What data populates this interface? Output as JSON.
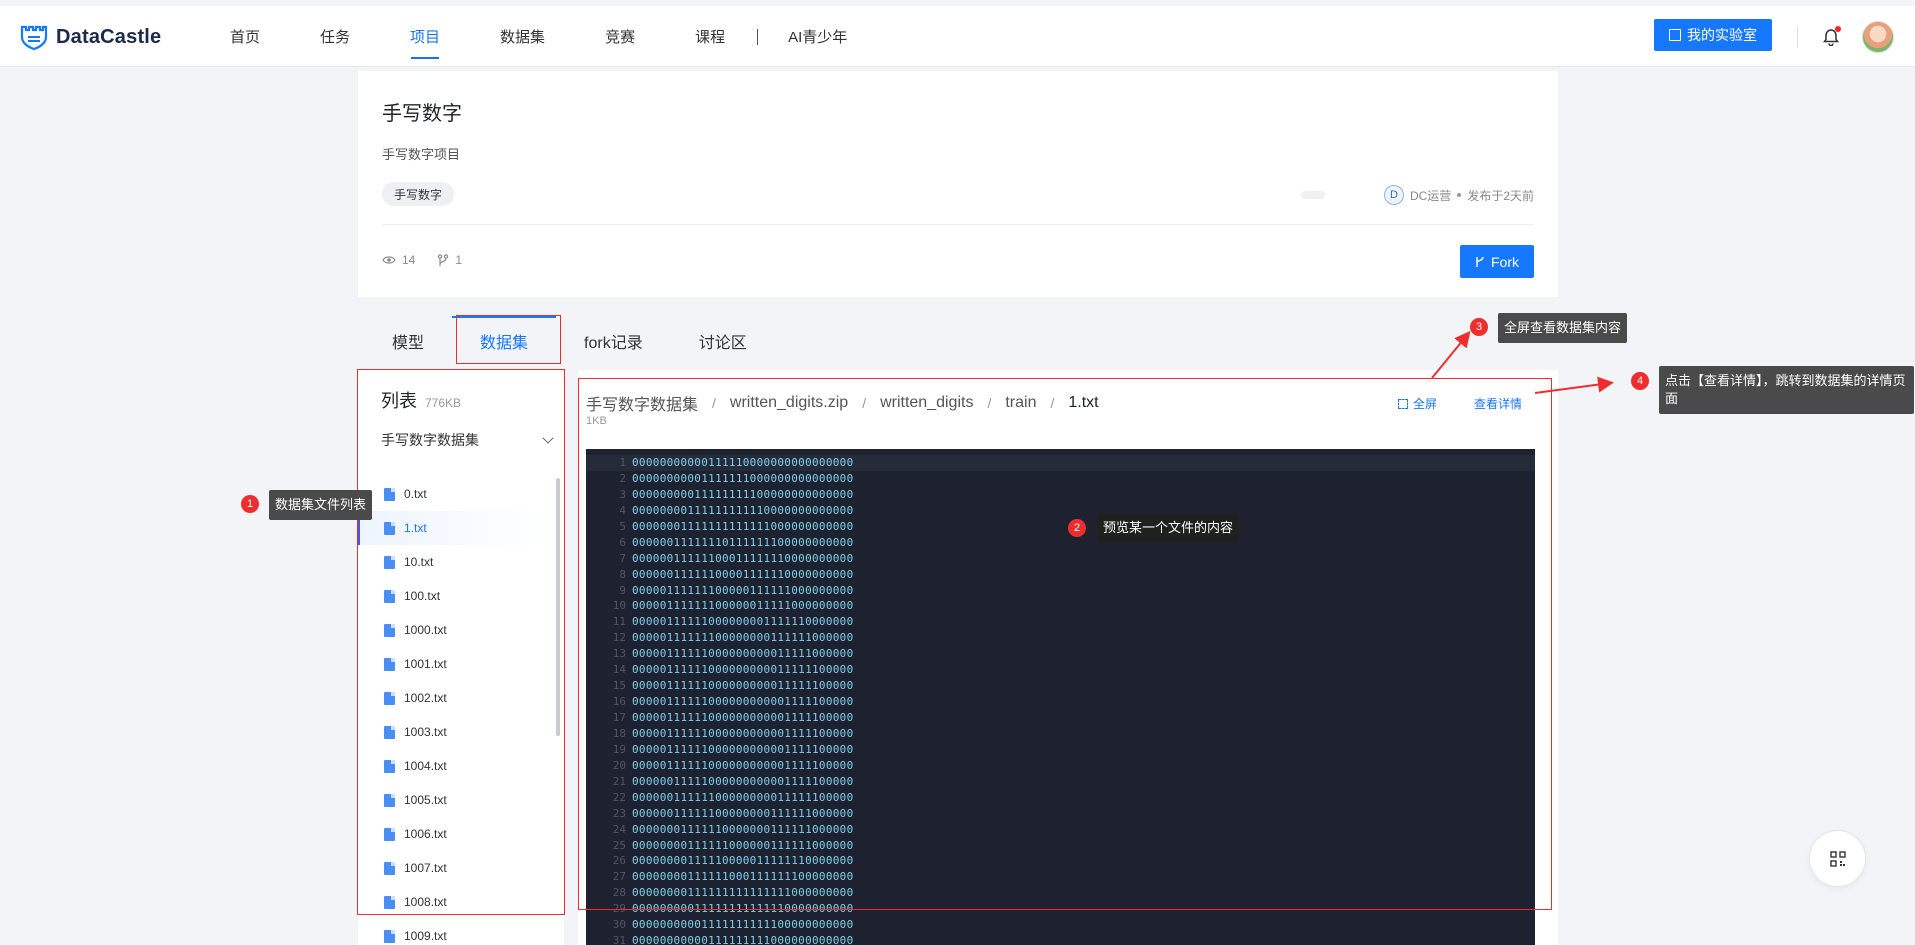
{
  "nav": {
    "brand": "DataCastle",
    "items": [
      {
        "label": "首页",
        "active": false
      },
      {
        "label": "任务",
        "active": false
      },
      {
        "label": "项目",
        "active": true
      },
      {
        "label": "数据集",
        "active": false
      },
      {
        "label": "竞赛",
        "active": false
      },
      {
        "label": "课程",
        "active": false
      }
    ],
    "extra_item": "AI青少年",
    "lab_button": "我的实验室"
  },
  "project": {
    "title": "手写数字",
    "description": "手写数字项目",
    "tag": "手写数字",
    "author_initial": "D",
    "author": "DC运营",
    "published": "发布于2天前",
    "views": "14",
    "forks": "1",
    "fork_button": "Fork"
  },
  "tabs": [
    "模型",
    "数据集",
    "fork记录",
    "讨论区"
  ],
  "active_tab": "数据集",
  "file_panel": {
    "title": "列表",
    "size": "776KB",
    "dataset": "手写数字数据集",
    "files": [
      "0.txt",
      "1.txt",
      "10.txt",
      "100.txt",
      "1000.txt",
      "1001.txt",
      "1002.txt",
      "1003.txt",
      "1004.txt",
      "1005.txt",
      "1006.txt",
      "1007.txt",
      "1008.txt",
      "1009.txt"
    ],
    "selected": "1.txt"
  },
  "preview": {
    "breadcrumb": [
      "手写数字数据集",
      "written_digits.zip",
      "written_digits",
      "train",
      "1.txt"
    ],
    "file_size": "1KB",
    "fullscreen": "全屏",
    "view_details": "查看详情",
    "lines": [
      "00000000000111110000000000000000",
      "00000000001111111000000000000000",
      "00000000011111111100000000000000",
      "00000000111111111110000000000000",
      "00000001111111111111000000000000",
      "00000011111110111111100000000000",
      "00000011111100011111110000000000",
      "00000011111100001111110000000000",
      "00000111111100000111111000000000",
      "00000111111100000011111000000000",
      "00000111111000000001111110000000",
      "00000111111100000000111111000000",
      "00000111111000000000011111000000",
      "00000111111000000000011111100000",
      "00000111111000000000011111100000",
      "00000111111000000000001111100000",
      "00000111111000000000001111100000",
      "00000111111000000000001111100000",
      "00000111111000000000001111100000",
      "00000111111000000000001111100000",
      "00000011111000000000001111100000",
      "00000011111100000000011111100000",
      "00000011111100000000111111000000",
      "00000001111110000000111111000000",
      "00000000111111000000111111000000",
      "00000000111110000011111110000000",
      "00000000111111000111111100000000",
      "00000000111111111111111000000000",
      "00000000011111111111110000000000",
      "00000000001111111111100000000000",
      "00000000000111111111000000000000"
    ]
  },
  "annotations": [
    {
      "num": "1",
      "text": "数据集文件列表"
    },
    {
      "num": "2",
      "text": "预览某一个文件的内容"
    },
    {
      "num": "3",
      "text": "全屏查看数据集内容"
    },
    {
      "num": "4",
      "text": "点击【查看详情】，跳转到数据集的详情页面"
    }
  ],
  "colors": {
    "accent": "#1677ff",
    "annotation": "#f02d2d",
    "code_bg": "#1e2230",
    "code_text": "#7fd0e8"
  }
}
